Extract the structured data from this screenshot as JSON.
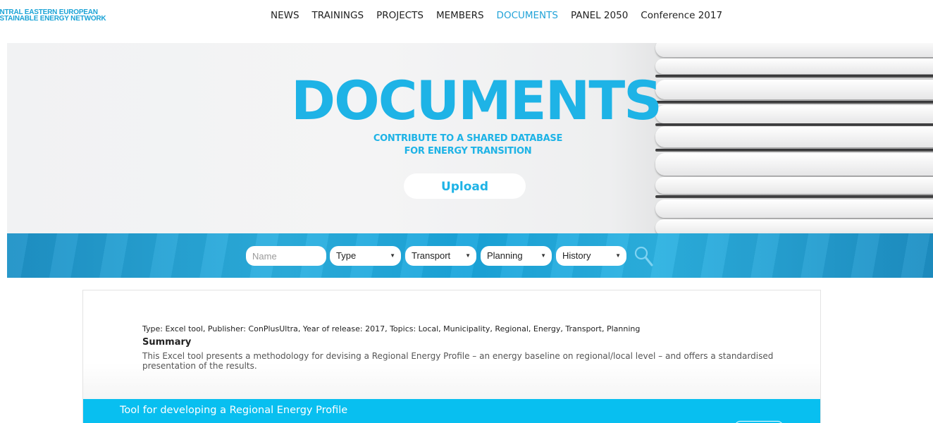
{
  "logo": {
    "line1": "CENTRAL EASTERN EUROPEAN",
    "line2": "SUSTAINABLE ENERGY NETWORK"
  },
  "nav": {
    "items": [
      {
        "label": "NEWS",
        "active": false
      },
      {
        "label": "TRAININGS",
        "active": false
      },
      {
        "label": "PROJECTS",
        "active": false
      },
      {
        "label": "MEMBERS",
        "active": false
      },
      {
        "label": "DOCUMENTS",
        "active": true
      },
      {
        "label": "PANEL 2050",
        "active": false
      },
      {
        "label": "Conference 2017",
        "active": false
      }
    ]
  },
  "hero": {
    "title": "DOCUMENTS",
    "subtitle_line1": "CONTRIBUTE TO A SHARED DATABASE",
    "subtitle_line2": "FOR ENERGY TRANSITION",
    "upload_label": "Upload"
  },
  "filters": {
    "name_placeholder": "Name",
    "type": "Type",
    "transport": "Transport",
    "planning": "Planning",
    "history": "History",
    "search_icon": "search-icon"
  },
  "document": {
    "meta": "Type: Excel tool, Publisher: ConPlusUltra, Year of release: 2017, Topics: Local, Municipality, Regional, Energy, Transport, Planning",
    "summary_heading": "Summary",
    "summary_text": "This Excel tool presents a methodology for devising a Regional Energy Profile – an energy baseline on regional/local level – and offers a standardised presentation of the results.",
    "title": "Tool for developing a Regional Energy Profile"
  },
  "colors": {
    "accent": "#1eb3e6",
    "nav_active": "#22a3d8",
    "doc_bar": "#08bff0"
  }
}
